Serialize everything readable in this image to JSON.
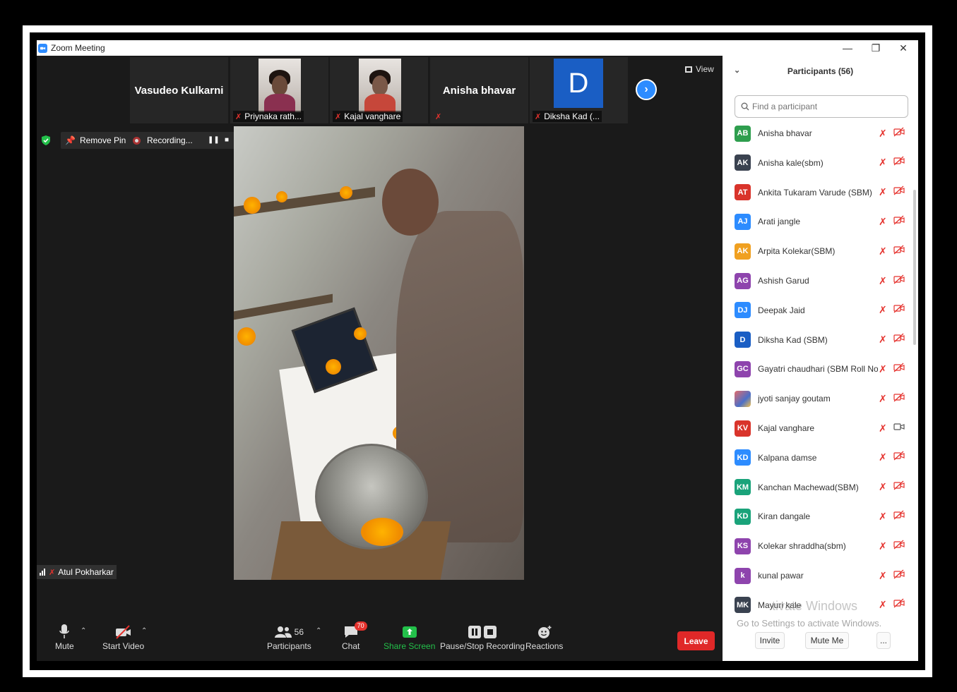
{
  "window": {
    "title": "Zoom Meeting"
  },
  "gallery": {
    "tiles": [
      {
        "name": "Vasudeo Kulkarni",
        "has_video": false
      },
      {
        "name": "Priynaka rath...",
        "has_video": true
      },
      {
        "name": "Kajal vanghare",
        "has_video": true
      },
      {
        "name": "Anisha bhavar",
        "has_video": false
      },
      {
        "name": "Diksha Kad (...",
        "initial": "D"
      }
    ],
    "view_label": "View"
  },
  "meeting_toolbar": {
    "remove_pin_label": "Remove Pin",
    "recording_label": "Recording..."
  },
  "active_speaker": {
    "name": "Atul Pokharkar"
  },
  "controls": {
    "mute_label": "Mute",
    "start_video_label": "Start Video",
    "participants_label": "Participants",
    "participants_count": "56",
    "chat_label": "Chat",
    "chat_badge": "70",
    "share_label": "Share Screen",
    "pause_stop_label": "Pause/Stop Recording",
    "reactions_label": "Reactions",
    "leave_label": "Leave"
  },
  "participants_panel": {
    "title": "Participants (56)",
    "search_placeholder": "Find a participant",
    "items": [
      {
        "initials": "AB",
        "name": "Anisha bhavar",
        "color": "#2e9e4e",
        "video": false
      },
      {
        "initials": "AK",
        "name": "Anisha kale(sbm)",
        "color": "#3a4250",
        "video": false
      },
      {
        "initials": "AT",
        "name": "Ankita Tukaram Varude  (SBM)",
        "color": "#d9342b",
        "video": false
      },
      {
        "initials": "AJ",
        "name": "Arati jangle",
        "color": "#2d8cff",
        "video": false
      },
      {
        "initials": "AK",
        "name": "Arpita Kolekar(SBM)",
        "color": "#f0a020",
        "video": false
      },
      {
        "initials": "AG",
        "name": "Ashish Garud",
        "color": "#8e44ad",
        "video": false
      },
      {
        "initials": "DJ",
        "name": "Deepak Jaid",
        "color": "#2d8cff",
        "video": false
      },
      {
        "initials": "D",
        "name": "Diksha Kad (SBM)",
        "color": "#1a5ec4",
        "video": false
      },
      {
        "initials": "GC",
        "name": "Gayatri chaudhari (SBM Roll No...",
        "color": "#8e44ad",
        "video": false
      },
      {
        "initials": "",
        "name": "jyoti sanjay goutam",
        "color": "#6a7fb5",
        "video": false
      },
      {
        "initials": "KV",
        "name": "Kajal vanghare",
        "color": "#d9342b",
        "video": true
      },
      {
        "initials": "KD",
        "name": "Kalpana damse",
        "color": "#2d8cff",
        "video": false
      },
      {
        "initials": "KM",
        "name": "Kanchan Machewad(SBM)",
        "color": "#1aa37a",
        "video": false
      },
      {
        "initials": "KD",
        "name": "Kiran dangale",
        "color": "#1aa37a",
        "video": false
      },
      {
        "initials": "KS",
        "name": "Kolekar shraddha(sbm)",
        "color": "#8e44ad",
        "video": false
      },
      {
        "initials": "k",
        "name": "kunal pawar",
        "color": "#8e44ad",
        "video": false
      },
      {
        "initials": "MK",
        "name": "Mayuri kale",
        "color": "#3a4250",
        "video": false
      }
    ],
    "watermark_title": "tivate Windows",
    "watermark_sub": "Go to Settings to activate Windows.",
    "invite_label": "Invite",
    "mute_me_label": "Mute Me",
    "more_label": "..."
  }
}
